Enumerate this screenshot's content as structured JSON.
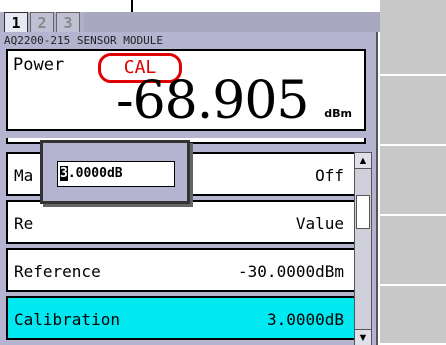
{
  "tabs": [
    {
      "label": "1"
    },
    {
      "label": "2"
    },
    {
      "label": "3"
    }
  ],
  "module": {
    "title": "AQ2200-215 SENSOR MODULE"
  },
  "measurement": {
    "label": "Power",
    "badge": "CAL",
    "value": "-68.905",
    "unit": "dBm"
  },
  "menu": {
    "items": [
      {
        "label": "Ma",
        "value": "Off"
      },
      {
        "label": "Re",
        "value": "Value"
      },
      {
        "label": "Reference",
        "value": "-30.0000dBm"
      },
      {
        "label": "Calibration",
        "value": "3.0000dB"
      }
    ]
  },
  "popup": {
    "cursor_char": "3",
    "rest": ".0000dB"
  },
  "scrollbar": {
    "up_glyph": "▲",
    "down_glyph": "▼"
  },
  "colors": {
    "badge": "#e00000",
    "selected_row": "#00e8f0",
    "panel": "#b4b4d0"
  }
}
